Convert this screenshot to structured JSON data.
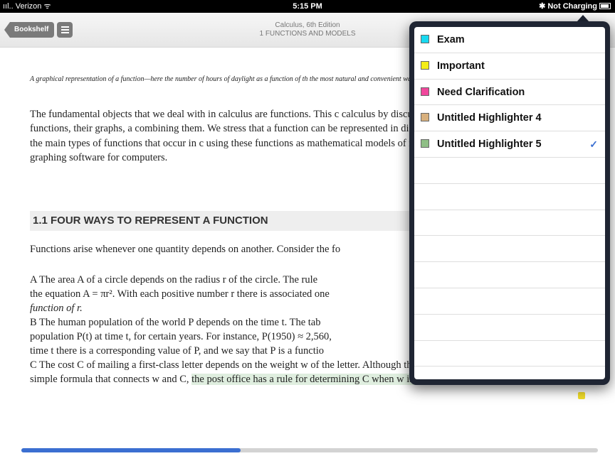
{
  "status_bar": {
    "carrier": "ııl.. Verizon ᯤ",
    "time": "5:15 PM",
    "battery": "✱ Not Charging"
  },
  "nav": {
    "back_label": "Bookshelf",
    "book_title": "Calculus, 6th Edition",
    "chapter": "1 FUNCTIONS AND MODELS"
  },
  "book": {
    "caption": "A graphical representation of a function—here the number of hours of daylight as a function of th the most natural and convenient way to represent the function.",
    "paragraph1": "The fundamental objects that we deal with in calculus are functions. This c calculus by discussing the basic ideas concerning functions, their graphs, a combining them. We stress that a function can be represented in different v a graph, or in words. We look at the main types of functions that occur in c using these functions as mathematical models of real-world phenomena. W calculators and graphing software for computers.",
    "section_heading": "1.1 FOUR WAYS TO REPRESENT A FUNCTION",
    "paragraph2": "Functions arise whenever one quantity depends on another. Consider the fo",
    "item_a_1": "A    The area A of a circle depends on the radius r of the circle. The rule",
    "item_a_2": "the equation A = πr². With each positive number r there is associated one",
    "item_a_3": "function of r.",
    "item_b_1": "B    The human population of the world P depends on the time t. The tab",
    "item_b_2": "population P(t) at time t, for certain years. For instance, P(1950) ≈ 2,560,",
    "item_b_3": "time t there is a corresponding value of P, and we say that P is a functio",
    "item_c_1": "C    The cost C of mailing a first-class letter depends on the weight w of the letter. Although there is no",
    "item_c_2a": "simple formula that connects w and C, ",
    "item_c_2b": "the post office has a rule for determining C when w is known."
  },
  "progress": {
    "fraction": 0.38
  },
  "highlighters": [
    {
      "label": "Exam",
      "color": "#19d9f0",
      "selected": false
    },
    {
      "label": "Important",
      "color": "#f4ee17",
      "selected": false
    },
    {
      "label": "Need Clarification",
      "color": "#f0479c",
      "selected": false
    },
    {
      "label": "Untitled Highlighter 4",
      "color": "#d8b07d",
      "selected": false
    },
    {
      "label": "Untitled Highlighter 5",
      "color": "#8fbf86",
      "selected": true
    }
  ],
  "check_glyph": "✓"
}
